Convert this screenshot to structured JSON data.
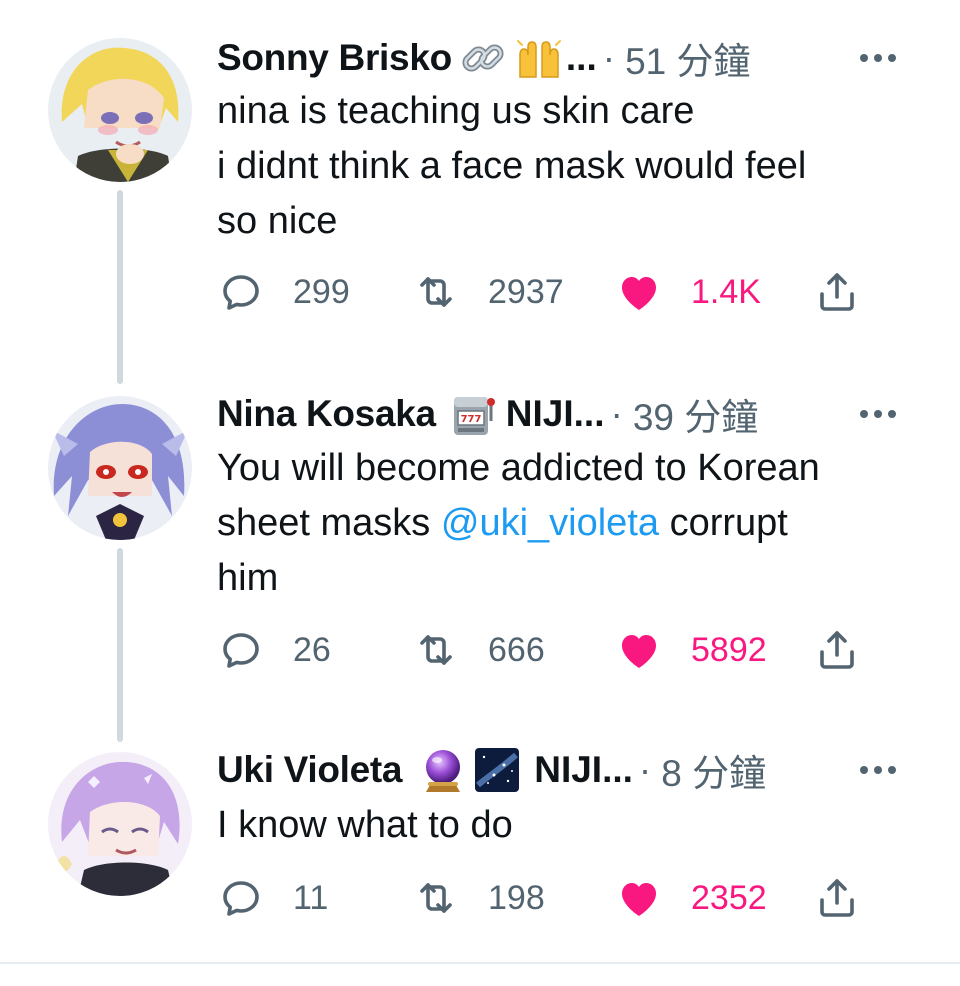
{
  "thread": {
    "tweets": [
      {
        "author_name": "Sonny Brisko",
        "author_emojis": [
          "link-emoji",
          "raising-hands-emoji"
        ],
        "name_truncation": "...",
        "separator": "·",
        "time": "51 分鐘",
        "text_lines": [
          "nina is teaching us skin care",
          "i didnt think a face mask would feel",
          "so nice"
        ],
        "mention": "",
        "replies": "299",
        "retweets": "2937",
        "likes": "1.4K",
        "liked": true
      },
      {
        "author_name": "Nina Kosaka",
        "author_emojis": [
          "slot-machine-emoji"
        ],
        "name_suffix": "NIJI...",
        "separator": "·",
        "time": "39 分鐘",
        "text_lines": [
          "You will become addicted to Korean",
          "sheet masks ",
          "him"
        ],
        "mention": "@uki_violeta",
        "mention_after": " corrupt",
        "replies": "26",
        "retweets": "666",
        "likes": "5892",
        "liked": true
      },
      {
        "author_name": "Uki Violeta",
        "author_emojis": [
          "crystal-ball-emoji",
          "milky-way-emoji"
        ],
        "name_suffix": "NIJI...",
        "separator": "·",
        "time": "8 分鐘",
        "text_lines": [
          "I know what to do"
        ],
        "mention": "",
        "replies": "11",
        "retweets": "198",
        "likes": "2352",
        "liked": true
      }
    ]
  },
  "colors": {
    "text": "#0f1419",
    "muted": "#536471",
    "like": "#f91880",
    "mention": "#1d9bf0",
    "thread_line": "#cfd9de"
  },
  "icons": {
    "reply": "reply-icon",
    "retweet": "retweet-icon",
    "like": "heart-icon",
    "share": "share-icon",
    "more": "more-icon"
  }
}
